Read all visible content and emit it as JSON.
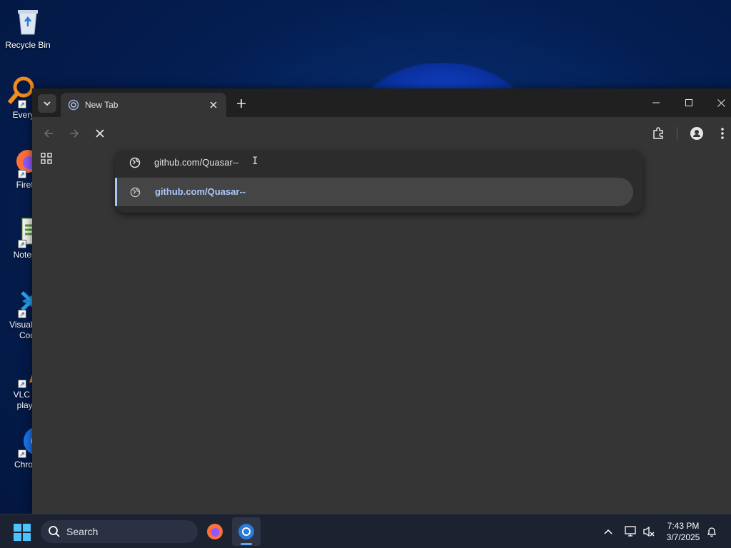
{
  "desktop": {
    "icons": [
      {
        "label": "Recycle Bin",
        "icon": "recycle-bin-icon"
      },
      {
        "label": "Everyth",
        "icon": "everything-search-icon"
      },
      {
        "label": "Firefo",
        "icon": "firefox-icon"
      },
      {
        "label": "Notepa",
        "icon": "notepad-icon"
      },
      {
        "label": "Visual S",
        "label2": "Cod",
        "icon": "vscode-icon"
      },
      {
        "label": "VLC m",
        "label2": "playe",
        "icon": "vlc-icon"
      },
      {
        "label": "Chrom",
        "icon": "chrome-icon"
      }
    ]
  },
  "browser": {
    "tab": {
      "title": "New Tab"
    },
    "omnibox": {
      "value": "github.com/Quasar--",
      "suggestion": "github.com/Quasar--"
    }
  },
  "taskbar": {
    "search_placeholder": "Search",
    "clock": {
      "time": "7:43 PM",
      "date": "3/7/2025"
    }
  },
  "colors": {
    "accent": "#a8c7fa",
    "window_bg": "#353535",
    "titlebar_bg": "#202020",
    "taskbar_bg": "#1c2230"
  }
}
